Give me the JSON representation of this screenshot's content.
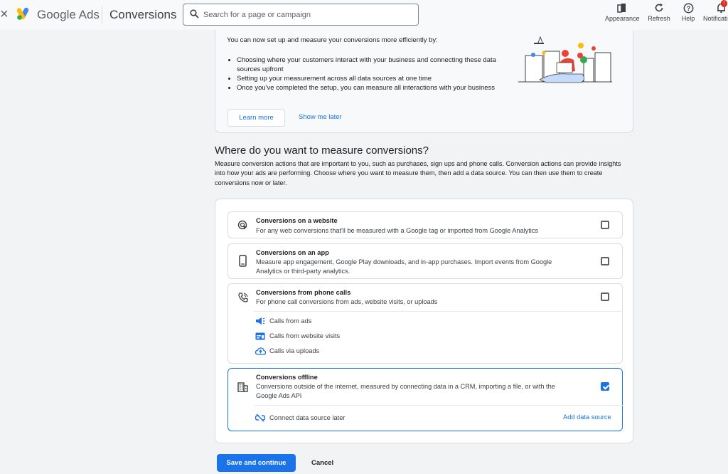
{
  "header": {
    "close_symbol": "×",
    "brand": "Google Ads",
    "page_title": "Conversions",
    "search_placeholder": "Search for a page or campaign",
    "tools": [
      {
        "label": "Appearance",
        "icon": "appearance-icon"
      },
      {
        "label": "Refresh",
        "icon": "refresh-icon"
      },
      {
        "label": "Help",
        "icon": "help-icon"
      },
      {
        "label": "Notifications",
        "icon": "bell-icon",
        "badge": "!"
      }
    ],
    "brand_colors": {
      "blue": "#4285f4",
      "yellow": "#fbbc04",
      "green": "#34a853"
    }
  },
  "intro": {
    "text": "You can now set up and measure your conversions more efficiently by:",
    "bullets": [
      "Choosing where your customers interact with your business and connecting these data sources upfront",
      "Setting up your measurement across all data sources at one time",
      "Once you've completed the setup, you can measure all interactions with your business"
    ],
    "learn_more": "Learn more",
    "show_later": "Show me later"
  },
  "section": {
    "title": "Where do you want to measure conversions?",
    "description": "Measure conversion actions that are important to you, such as purchases, sign ups and phone calls. Conversion actions can provide insights into how your ads are performing. Choose where you want to measure them, then add a data source. You can then use them to create conversions now or later."
  },
  "options": [
    {
      "title": "Conversions on a website",
      "desc": "For any web conversions that'll be measured with a Google tag or imported from Google Analytics",
      "icon": "website-cursor-icon",
      "checked": false
    },
    {
      "title": "Conversions on an app",
      "desc": "Measure app engagement, Google Play downloads, and in-app purchases. Import events from Google Analytics or third-party analytics.",
      "icon": "phone-device-icon",
      "checked": false
    },
    {
      "title": "Conversions from phone calls",
      "desc": "For phone call conversions from ads, website visits, or uploads",
      "icon": "phone-call-icon",
      "checked": false,
      "sub": [
        {
          "label": "Calls from ads",
          "icon": "megaphone-icon"
        },
        {
          "label": "Calls from website visits",
          "icon": "web-page-icon"
        },
        {
          "label": "Calls via uploads",
          "icon": "cloud-upload-icon"
        }
      ]
    },
    {
      "title": "Conversions offline",
      "desc": "Conversions outside of the internet, measured by connecting data in a CRM, importing a file, or with the Google Ads API",
      "icon": "building-icon",
      "checked": true,
      "connect_later": "Connect data source later",
      "add_source": "Add data source"
    }
  ],
  "footer": {
    "save": "Save and continue",
    "cancel": "Cancel"
  },
  "colors": {
    "accent": "#1a73e8",
    "border": "#dadce0",
    "page_bg": "#f1f3f4"
  }
}
